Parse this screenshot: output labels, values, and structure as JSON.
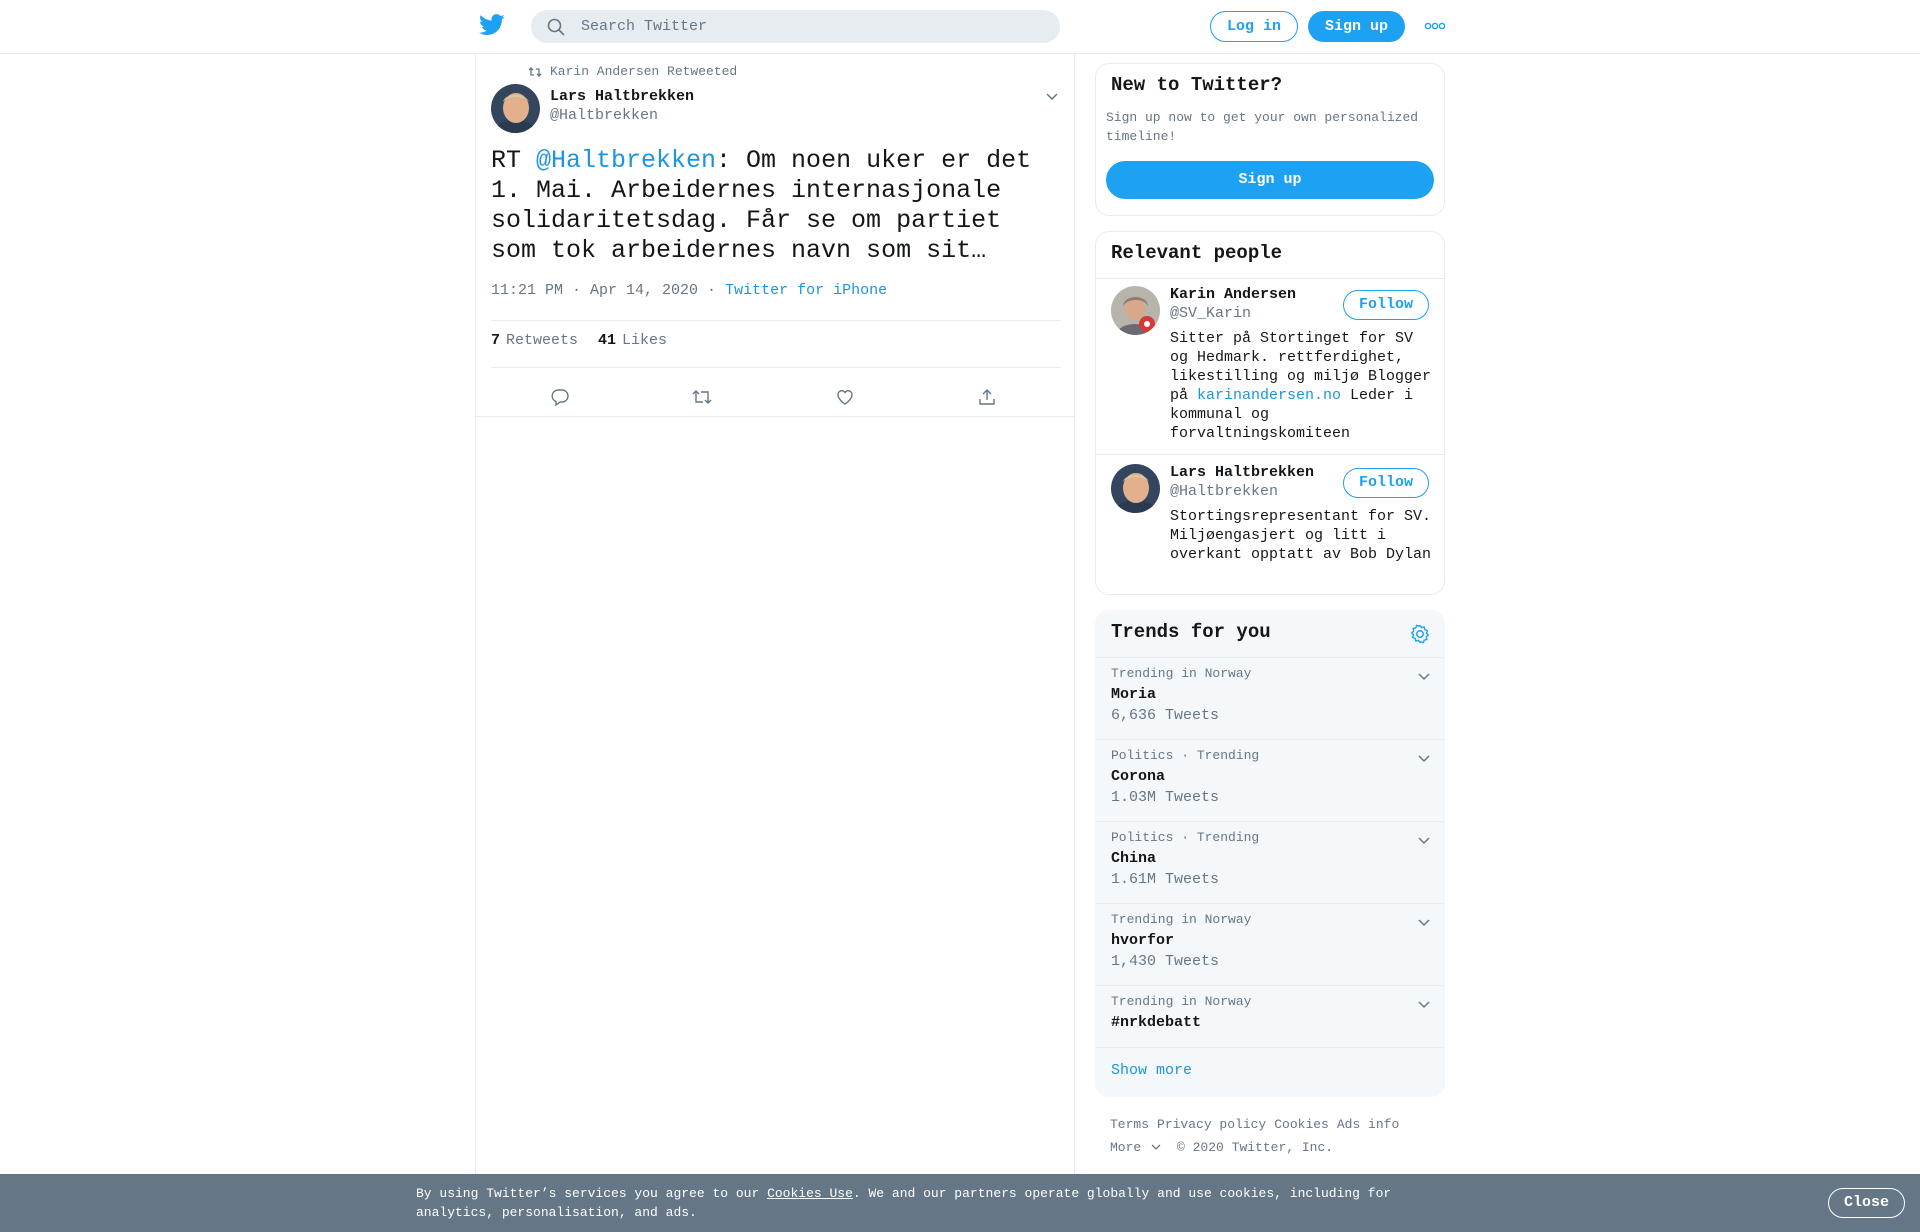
{
  "header": {
    "search_placeholder": "Search Twitter",
    "login_label": "Log in",
    "signup_label": "Sign up",
    "icons": [
      "twitter-logo-icon",
      "search-icon",
      "more-icon"
    ],
    "accent_color": "#1da1f2"
  },
  "tweet": {
    "retweeted_by": "Karin Andersen Retweeted",
    "author_name": "Lars Haltbrekken",
    "author_handle": "@Haltbrekken",
    "text_prefix": "RT ",
    "text_mention": "@Haltbrekken",
    "text_body": ": Om noen uker er det 1. Mai. Arbeidernes internasjonale solidaritetsdag. Får se om partiet som tok arbeidernes navn som sit…",
    "timestamp": "11:21 PM · Apr 14, 2020",
    "separator": " · ",
    "source": "Twitter for iPhone",
    "retweets_count": "7",
    "retweets_label": "Retweets",
    "likes_count": "41",
    "likes_label": "Likes",
    "actions": [
      "reply-icon",
      "retweet-icon",
      "like-icon",
      "share-icon"
    ]
  },
  "sidebar": {
    "new_to_twitter": {
      "title": "New to Twitter?",
      "subtitle": "Sign up now to get your own personalized timeline!",
      "button": "Sign up"
    },
    "relevant_people": {
      "title": "Relevant people",
      "people": [
        {
          "name": "Karin Andersen",
          "handle": "@SV_Karin",
          "follow": "Follow",
          "bio_before_link": "Sitter på Stortinget for SV og Hedmark. rettferdighet, likestilling og miljø Blogger på ",
          "bio_link": "karinandersen.no",
          "bio_after_link": " Leder i kommunal og forvaltningskomiteen"
        },
        {
          "name": "Lars Haltbrekken",
          "handle": "@Haltbrekken",
          "follow": "Follow",
          "bio": "Stortingsrepresentant for SV. Miljøengasjert og litt i overkant opptatt av Bob Dylan"
        }
      ]
    },
    "trends": {
      "title": "Trends for you",
      "items": [
        {
          "context": "Trending in Norway",
          "name": "Moria",
          "count": "6,636 Tweets"
        },
        {
          "context": "Politics · Trending",
          "name": "Corona",
          "count": "1.03M Tweets"
        },
        {
          "context": "Politics · Trending",
          "name": "China",
          "count": "1.61M Tweets"
        },
        {
          "context": "Trending in Norway",
          "name": "hvorfor",
          "count": "1,430 Tweets"
        },
        {
          "context": "Trending in Norway",
          "name": "#nrkdebatt",
          "count": ""
        }
      ],
      "show_more": "Show more"
    },
    "footer": {
      "links": [
        "Terms",
        "Privacy policy",
        "Cookies",
        "Ads info"
      ],
      "more": "More",
      "copyright": "© 2020 Twitter, Inc."
    }
  },
  "cookie_banner": {
    "text_before": "By using Twitter’s services you agree to our ",
    "link": "Cookies Use",
    "text_after": ". We and our partners operate globally and use cookies, including for analytics, personalisation, and ads.",
    "close": "Close",
    "background": "#657786"
  }
}
